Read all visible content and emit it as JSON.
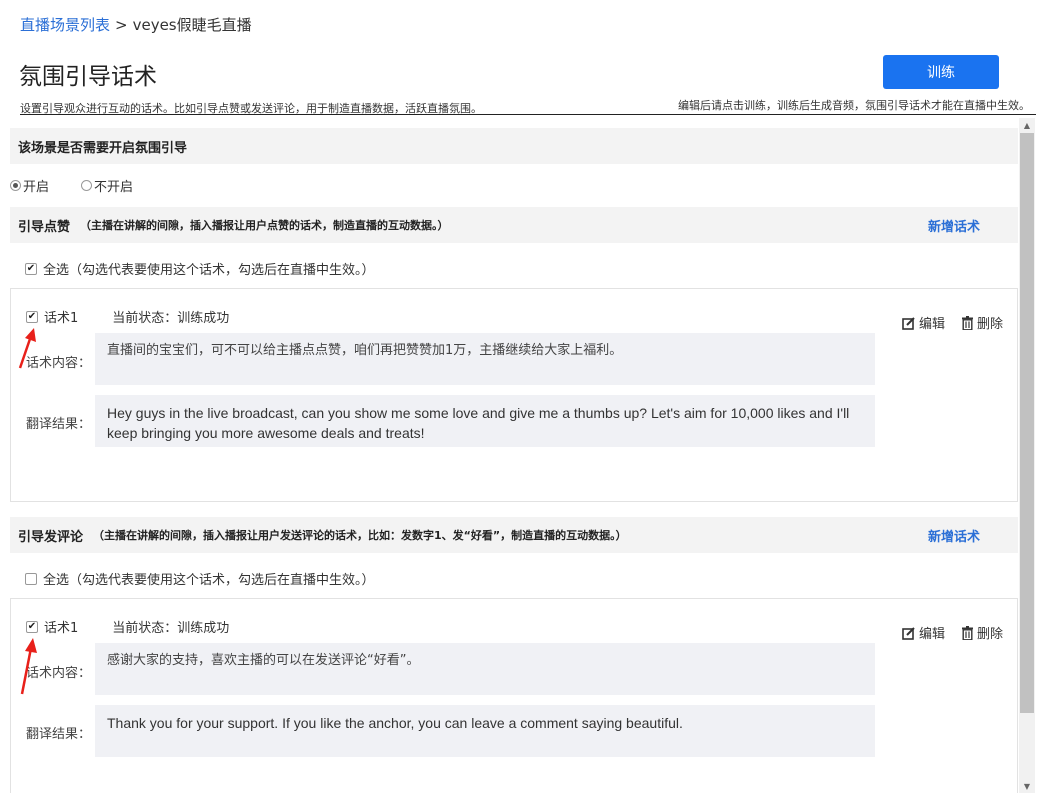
{
  "breadcrumb": {
    "link": "直播场景列表",
    "separator": ">",
    "current": "veyes假睫毛直播"
  },
  "header": {
    "title": "氛围引导话术",
    "train_button": "训练",
    "desc_left": "设置引导观众进行互动的话术。比如引导点赞或发送评论，用于制造直播数据，活跃直播氛围。",
    "desc_right": "编辑后请点击训练，训练后生成音频，氛围引导话术才能在直播中生效。"
  },
  "atmosphere": {
    "question": "该场景是否需要开启氛围引导",
    "options": [
      {
        "label": "开启",
        "selected": true
      },
      {
        "label": "不开启",
        "selected": false
      }
    ]
  },
  "sections": [
    {
      "title": "引导点赞",
      "note": "（主播在讲解的间隙，插入播报让用户点赞的话术，制造直播的互动数据。）",
      "add_label": "新增话术",
      "select_all": {
        "checked": true,
        "label": "全选（勾选代表要使用这个话术，勾选后在直播中生效。）"
      },
      "items": [
        {
          "checked": true,
          "name": "话术1",
          "status": "当前状态：训练成功",
          "edit_label": "编辑",
          "delete_label": "删除",
          "content_label": "话术内容：",
          "content": "直播间的宝宝们，可不可以给主播点点赞，咱们再把赞赞加1万，主播继续给大家上福利。",
          "translation_label": "翻译结果：",
          "translation": "Hey guys in the live broadcast, can you show me some love and give me a thumbs up? Let's aim for 10,000 likes and I'll keep bringing you more awesome deals and treats!"
        }
      ]
    },
    {
      "title": "引导发评论",
      "note": "（主播在讲解的间隙，插入播报让用户发送评论的话术，比如：发数字1、发“好看”，制造直播的互动数据。）",
      "add_label": "新增话术",
      "select_all": {
        "checked": false,
        "label": "全选（勾选代表要使用这个话术，勾选后在直播中生效。）"
      },
      "items": [
        {
          "checked": true,
          "name": "话术1",
          "status": "当前状态：训练成功",
          "edit_label": "编辑",
          "delete_label": "删除",
          "content_label": "话术内容：",
          "content": "感谢大家的支持，喜欢主播的可以在发送评论“好看”。",
          "translation_label": "翻译结果：",
          "translation": "Thank you for your support. If you like the anchor, you can leave a comment saying beautiful."
        }
      ]
    }
  ],
  "colors": {
    "accent": "#1a73f0",
    "link": "#2b6fd6",
    "annotation_arrow": "#e8201a"
  },
  "icons": {
    "edit": "edit-icon",
    "delete": "trash-icon"
  }
}
